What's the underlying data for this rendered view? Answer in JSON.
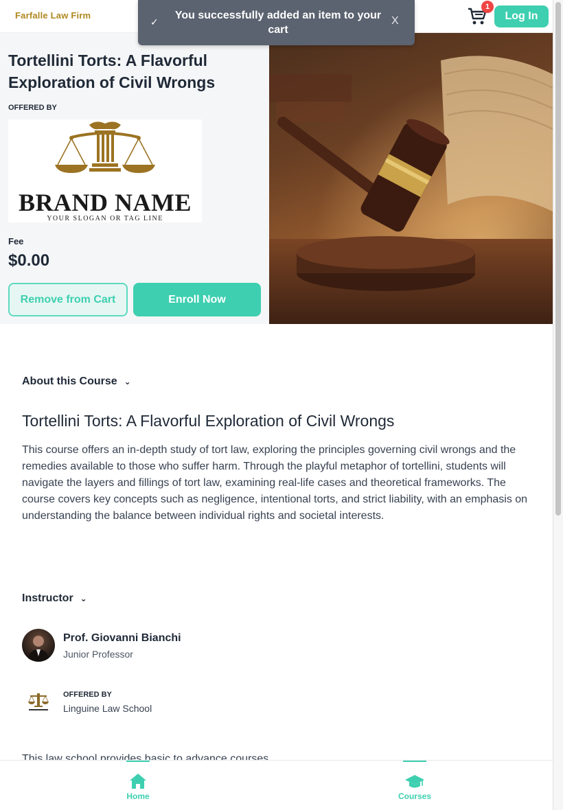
{
  "header": {
    "logo_text": "Farfalle Law Firm",
    "cart_count": "1",
    "login_label": "Log In"
  },
  "toast": {
    "message": "You successfully added an item to your cart",
    "close_label": "X"
  },
  "course": {
    "title": "Tortellini Torts: A Flavorful Exploration of Civil Wrongs",
    "offered_by_label": "OFFERED BY",
    "brand_name": "BRAND NAME",
    "brand_slogan": "YOUR SLOGAN OR TAG LINE",
    "fee_label": "Fee",
    "fee_value": "$0.00",
    "remove_label": "Remove from Cart",
    "enroll_label": "Enroll Now"
  },
  "about": {
    "heading": "About this Course",
    "title": "Tortellini Torts: A Flavorful Exploration of Civil Wrongs",
    "description": "This course offers an in-depth study of tort law, exploring the principles governing civil wrongs and the remedies available to those who suffer harm. Through the playful metaphor of tortellini, students will navigate the layers and fillings of tort law, examining real-life cases and theoretical frameworks. The course covers key concepts such as negligence, intentional torts, and strict liability, with an emphasis on understanding the balance between individual rights and societal interests."
  },
  "instructor": {
    "heading": "Instructor",
    "name": "Prof. Giovanni Bianchi",
    "role": "Junior Professor",
    "offered_by_label": "OFFERED BY",
    "school_name": "Linguine Law School",
    "school_description": "This law school provides basic to advance courses."
  },
  "bottom_nav": {
    "home_label": "Home",
    "courses_label": "Courses"
  },
  "colors": {
    "accent": "#3ecfb0",
    "badge": "#ef4444",
    "toast_bg": "#5b6270",
    "logo_gold": "#b08820"
  }
}
